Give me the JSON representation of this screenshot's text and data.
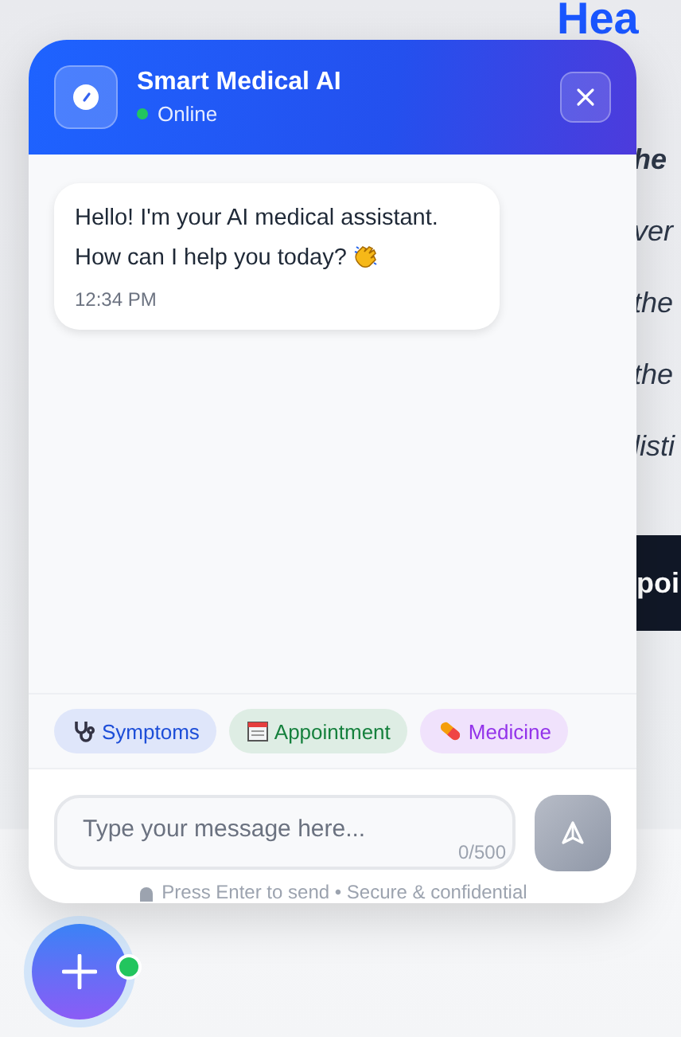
{
  "page": {
    "heading": "Hea",
    "lines": [
      "he",
      "ver",
      "the",
      "the",
      "listi"
    ],
    "button": "poi"
  },
  "chat": {
    "title": "Smart Medical AI",
    "status": "Online",
    "online": true,
    "messages": [
      {
        "text": "Hello! I'm your AI medical assistant. How can I help you today?",
        "time": "12:34 PM"
      }
    ],
    "quick_actions": [
      {
        "label": "Symptoms",
        "color": "#1d4ed8"
      },
      {
        "label": "Appointment",
        "color": "#15803d"
      },
      {
        "label": "Medicine",
        "color": "#9333ea"
      }
    ],
    "input": {
      "placeholder": "Type your message here...",
      "counter": "0/500"
    },
    "hint": "Press Enter to send • Secure & confidential"
  },
  "fab": {
    "online": true
  }
}
